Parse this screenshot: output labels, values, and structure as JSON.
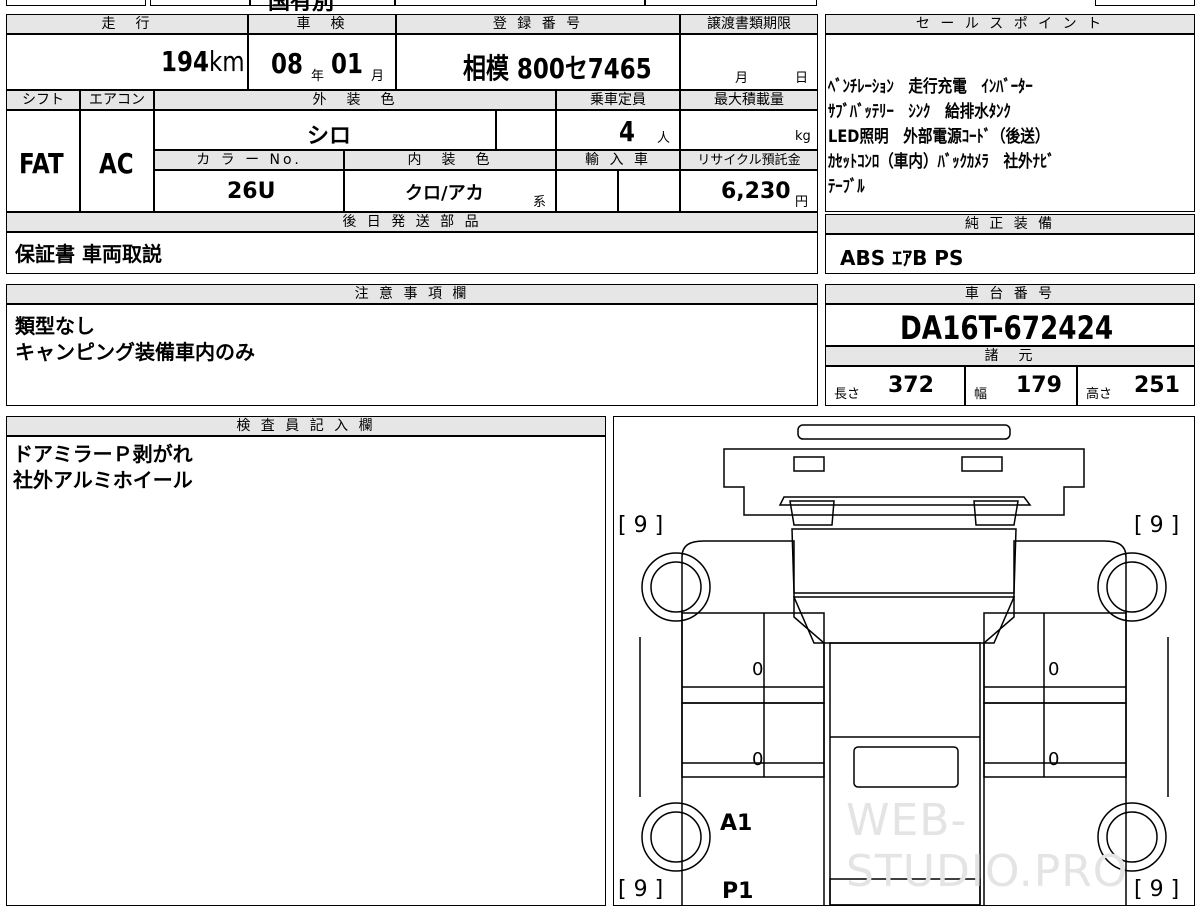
{
  "top_fragment": "国有別",
  "vehicle": {
    "mileage_header": "走　行",
    "mileage": "194",
    "mileage_unit": "km",
    "inspection_header": "車　検",
    "inspection_year": "08",
    "year_unit": "年",
    "inspection_month": "01",
    "month_unit": "月",
    "reg_header": "登 録 番 号",
    "reg_number": "相模 800セ7465",
    "transfer_header": "譲渡書類期限",
    "transfer_month_label": "月",
    "transfer_day_label": "日",
    "shift_header": "シフト",
    "ac_header": "エアコン",
    "shift": "FAT",
    "ac": "AC",
    "ext_color_header": "外　装　色",
    "ext_color": "シロ",
    "capacity_header": "乗車定員",
    "capacity": "4",
    "capacity_unit": "人",
    "max_load_header": "最大積載量",
    "max_load_unit": "kg",
    "color_no_header": "カ ラ ー No.",
    "color_no": "26U",
    "int_color_header": "内　装　色",
    "int_color": "クロ/アカ",
    "int_color_unit": "系",
    "import_header": "輸 入 車",
    "recycle_header": "リサイクル預託金",
    "recycle_fee": "6,230",
    "recycle_unit": "円"
  },
  "later_parts": {
    "header": "後 日 発 送 部 品",
    "value": "保証書 車両取説"
  },
  "notice": {
    "header": "注 意 事 項 欄",
    "lines": [
      "類型なし",
      "キャンピング装備車内のみ"
    ]
  },
  "sales_points": {
    "header": "セ ー ル ス ポ イ ン ト",
    "lines": [
      "ﾍﾞﾝﾁﾚｰｼｮﾝ　走行充電　ｲﾝﾊﾞｰﾀｰ",
      "ｻﾌﾞﾊﾞｯﾃﾘｰ　ｼﾝｸ　給排水ﾀﾝｸ",
      "LED照明　外部電源ｺｰﾄﾞ（後送）",
      "ｶｾｯﾄｺﾝﾛ（車内）ﾊﾞｯｸｶﾒﾗ　社外ﾅﾋﾞ",
      "ﾃｰﾌﾞﾙ"
    ]
  },
  "standard_equipment": {
    "header": "純 正 装 備",
    "value": "ABS ｴｱB PS"
  },
  "chassis": {
    "header": "車 台 番 号",
    "value": "DA16T-672424"
  },
  "specs": {
    "header": "諸　元",
    "length_label": "長さ",
    "length": "372",
    "width_label": "幅",
    "width": "179",
    "height_label": "高さ",
    "height": "251"
  },
  "inspector": {
    "header": "検 査 員 記 入 欄",
    "lines": [
      "ドアミラーＰ剥がれ",
      "社外アルミホイール"
    ]
  },
  "diagram": {
    "tire_fl": "[ 9 ]",
    "tire_fr": "[ 9 ]",
    "tire_rl": "[ 9 ]",
    "tire_rr": "[ 9 ]",
    "door_l1": "0",
    "door_r1": "0",
    "door_l2": "0",
    "door_r2": "0",
    "mark_a1": "A1",
    "mark_p1": "P1",
    "watermark": "WEB-STUDIO.PRO"
  }
}
